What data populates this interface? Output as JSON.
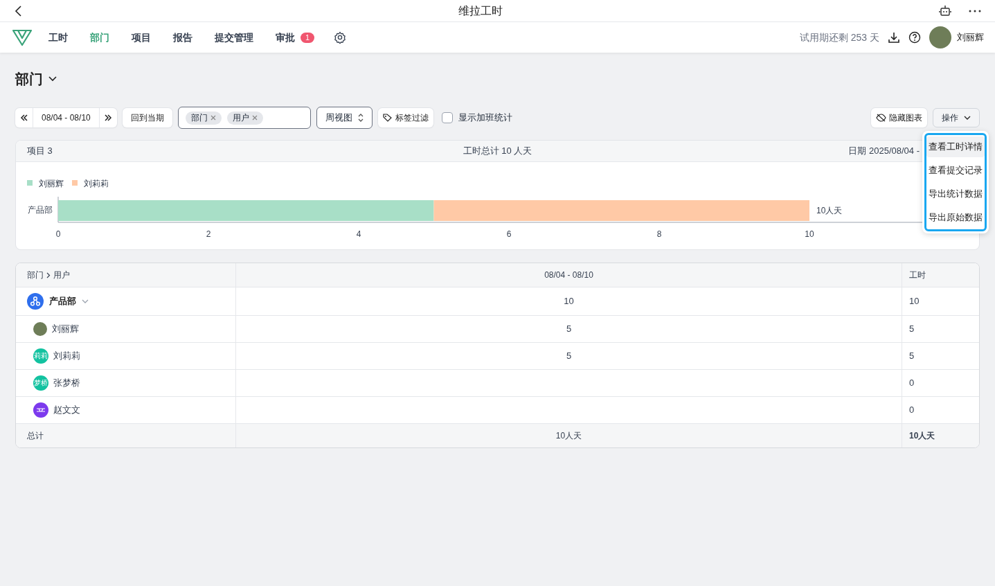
{
  "app_bar": {
    "title": "维拉工时"
  },
  "nav": {
    "items": [
      {
        "label": "工时",
        "selected": false
      },
      {
        "label": "部门",
        "selected": true
      },
      {
        "label": "项目",
        "selected": false
      },
      {
        "label": "报告",
        "selected": false
      },
      {
        "label": "提交管理",
        "selected": false
      },
      {
        "label": "审批",
        "selected": false,
        "badge": "1"
      }
    ],
    "trial": "试用期还剩 253 天",
    "user": "刘丽辉"
  },
  "page": {
    "title": "部门"
  },
  "toolbar": {
    "date_range": "08/04 - 08/10",
    "back_to_current": "回到当期",
    "group_tags": [
      "部门",
      "用户"
    ],
    "view": "周视图",
    "tag_filter": "标签过滤",
    "overtime": {
      "label": "显示加班统计",
      "checked": false
    },
    "hide_chart": "隐藏图表",
    "actions": "操作"
  },
  "actions_menu": {
    "items": [
      {
        "label": "查看工时详情",
        "selected": true
      },
      {
        "label": "查看提交记录",
        "selected": false
      },
      {
        "label": "导出统计数据",
        "selected": false
      },
      {
        "label": "导出原始数据",
        "selected": false
      }
    ]
  },
  "summary": {
    "projects": "项目 3",
    "total": "工时总计 10 人天",
    "date": "日期 2025/08/04 -"
  },
  "chart": {
    "chart_data": {
      "type": "bar",
      "orientation": "horizontal",
      "stacked": true,
      "categories": [
        "产品部"
      ],
      "series": [
        {
          "name": "刘丽辉",
          "color": "#a8dfc7",
          "values": [
            5
          ]
        },
        {
          "name": "刘莉莉",
          "color": "#ffc9a6",
          "values": [
            5
          ]
        }
      ],
      "xlim": [
        0,
        12
      ],
      "xticks": [
        0,
        2,
        4,
        6,
        8,
        10
      ],
      "value_labels": [
        "10人天"
      ],
      "legend": "top"
    }
  },
  "table": {
    "columns": [
      {
        "parts": [
          "部门",
          "用户"
        ]
      },
      {
        "label": "08/04 - 08/10"
      },
      {
        "label": "工时"
      }
    ],
    "group": {
      "name": "产品部",
      "expanded": true,
      "period": "10",
      "total": "10",
      "children": [
        {
          "name": "刘丽辉",
          "avatar": {
            "kind": "photo"
          },
          "period": "5",
          "total": "5"
        },
        {
          "name": "刘莉莉",
          "avatar": {
            "kind": "initials",
            "text": "莉莉",
            "color": "#12c2a0"
          },
          "period": "5",
          "total": "5"
        },
        {
          "name": "张梦桥",
          "avatar": {
            "kind": "initials",
            "text": "梦桥",
            "color": "#12c2a0"
          },
          "total": "0"
        },
        {
          "name": "赵文文",
          "avatar": {
            "kind": "icon",
            "color": "#7c3aed"
          },
          "total": "0"
        }
      ]
    },
    "footer": {
      "label": "总计",
      "period": "10人天",
      "total": "10人天"
    }
  }
}
